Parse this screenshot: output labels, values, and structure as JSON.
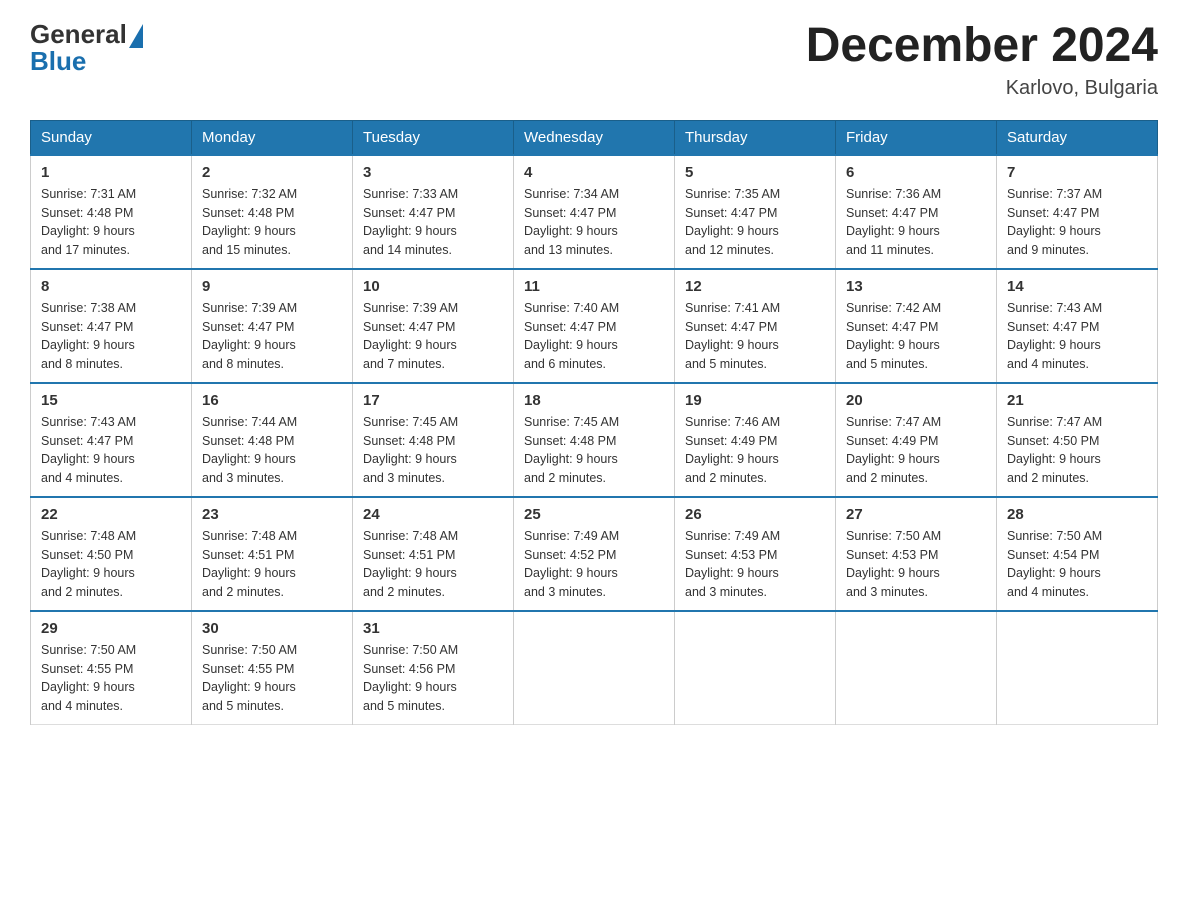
{
  "header": {
    "logo_general": "General",
    "logo_blue": "Blue",
    "month_title": "December 2024",
    "location": "Karlovo, Bulgaria"
  },
  "days_of_week": [
    "Sunday",
    "Monday",
    "Tuesday",
    "Wednesday",
    "Thursday",
    "Friday",
    "Saturday"
  ],
  "weeks": [
    [
      {
        "day": "1",
        "sunrise": "7:31 AM",
        "sunset": "4:48 PM",
        "daylight": "9 hours and 17 minutes."
      },
      {
        "day": "2",
        "sunrise": "7:32 AM",
        "sunset": "4:48 PM",
        "daylight": "9 hours and 15 minutes."
      },
      {
        "day": "3",
        "sunrise": "7:33 AM",
        "sunset": "4:47 PM",
        "daylight": "9 hours and 14 minutes."
      },
      {
        "day": "4",
        "sunrise": "7:34 AM",
        "sunset": "4:47 PM",
        "daylight": "9 hours and 13 minutes."
      },
      {
        "day": "5",
        "sunrise": "7:35 AM",
        "sunset": "4:47 PM",
        "daylight": "9 hours and 12 minutes."
      },
      {
        "day": "6",
        "sunrise": "7:36 AM",
        "sunset": "4:47 PM",
        "daylight": "9 hours and 11 minutes."
      },
      {
        "day": "7",
        "sunrise": "7:37 AM",
        "sunset": "4:47 PM",
        "daylight": "9 hours and 9 minutes."
      }
    ],
    [
      {
        "day": "8",
        "sunrise": "7:38 AM",
        "sunset": "4:47 PM",
        "daylight": "9 hours and 8 minutes."
      },
      {
        "day": "9",
        "sunrise": "7:39 AM",
        "sunset": "4:47 PM",
        "daylight": "9 hours and 8 minutes."
      },
      {
        "day": "10",
        "sunrise": "7:39 AM",
        "sunset": "4:47 PM",
        "daylight": "9 hours and 7 minutes."
      },
      {
        "day": "11",
        "sunrise": "7:40 AM",
        "sunset": "4:47 PM",
        "daylight": "9 hours and 6 minutes."
      },
      {
        "day": "12",
        "sunrise": "7:41 AM",
        "sunset": "4:47 PM",
        "daylight": "9 hours and 5 minutes."
      },
      {
        "day": "13",
        "sunrise": "7:42 AM",
        "sunset": "4:47 PM",
        "daylight": "9 hours and 5 minutes."
      },
      {
        "day": "14",
        "sunrise": "7:43 AM",
        "sunset": "4:47 PM",
        "daylight": "9 hours and 4 minutes."
      }
    ],
    [
      {
        "day": "15",
        "sunrise": "7:43 AM",
        "sunset": "4:47 PM",
        "daylight": "9 hours and 4 minutes."
      },
      {
        "day": "16",
        "sunrise": "7:44 AM",
        "sunset": "4:48 PM",
        "daylight": "9 hours and 3 minutes."
      },
      {
        "day": "17",
        "sunrise": "7:45 AM",
        "sunset": "4:48 PM",
        "daylight": "9 hours and 3 minutes."
      },
      {
        "day": "18",
        "sunrise": "7:45 AM",
        "sunset": "4:48 PM",
        "daylight": "9 hours and 2 minutes."
      },
      {
        "day": "19",
        "sunrise": "7:46 AM",
        "sunset": "4:49 PM",
        "daylight": "9 hours and 2 minutes."
      },
      {
        "day": "20",
        "sunrise": "7:47 AM",
        "sunset": "4:49 PM",
        "daylight": "9 hours and 2 minutes."
      },
      {
        "day": "21",
        "sunrise": "7:47 AM",
        "sunset": "4:50 PM",
        "daylight": "9 hours and 2 minutes."
      }
    ],
    [
      {
        "day": "22",
        "sunrise": "7:48 AM",
        "sunset": "4:50 PM",
        "daylight": "9 hours and 2 minutes."
      },
      {
        "day": "23",
        "sunrise": "7:48 AM",
        "sunset": "4:51 PM",
        "daylight": "9 hours and 2 minutes."
      },
      {
        "day": "24",
        "sunrise": "7:48 AM",
        "sunset": "4:51 PM",
        "daylight": "9 hours and 2 minutes."
      },
      {
        "day": "25",
        "sunrise": "7:49 AM",
        "sunset": "4:52 PM",
        "daylight": "9 hours and 3 minutes."
      },
      {
        "day": "26",
        "sunrise": "7:49 AM",
        "sunset": "4:53 PM",
        "daylight": "9 hours and 3 minutes."
      },
      {
        "day": "27",
        "sunrise": "7:50 AM",
        "sunset": "4:53 PM",
        "daylight": "9 hours and 3 minutes."
      },
      {
        "day": "28",
        "sunrise": "7:50 AM",
        "sunset": "4:54 PM",
        "daylight": "9 hours and 4 minutes."
      }
    ],
    [
      {
        "day": "29",
        "sunrise": "7:50 AM",
        "sunset": "4:55 PM",
        "daylight": "9 hours and 4 minutes."
      },
      {
        "day": "30",
        "sunrise": "7:50 AM",
        "sunset": "4:55 PM",
        "daylight": "9 hours and 5 minutes."
      },
      {
        "day": "31",
        "sunrise": "7:50 AM",
        "sunset": "4:56 PM",
        "daylight": "9 hours and 5 minutes."
      },
      null,
      null,
      null,
      null
    ]
  ],
  "labels": {
    "sunrise": "Sunrise:",
    "sunset": "Sunset:",
    "daylight": "Daylight:"
  }
}
